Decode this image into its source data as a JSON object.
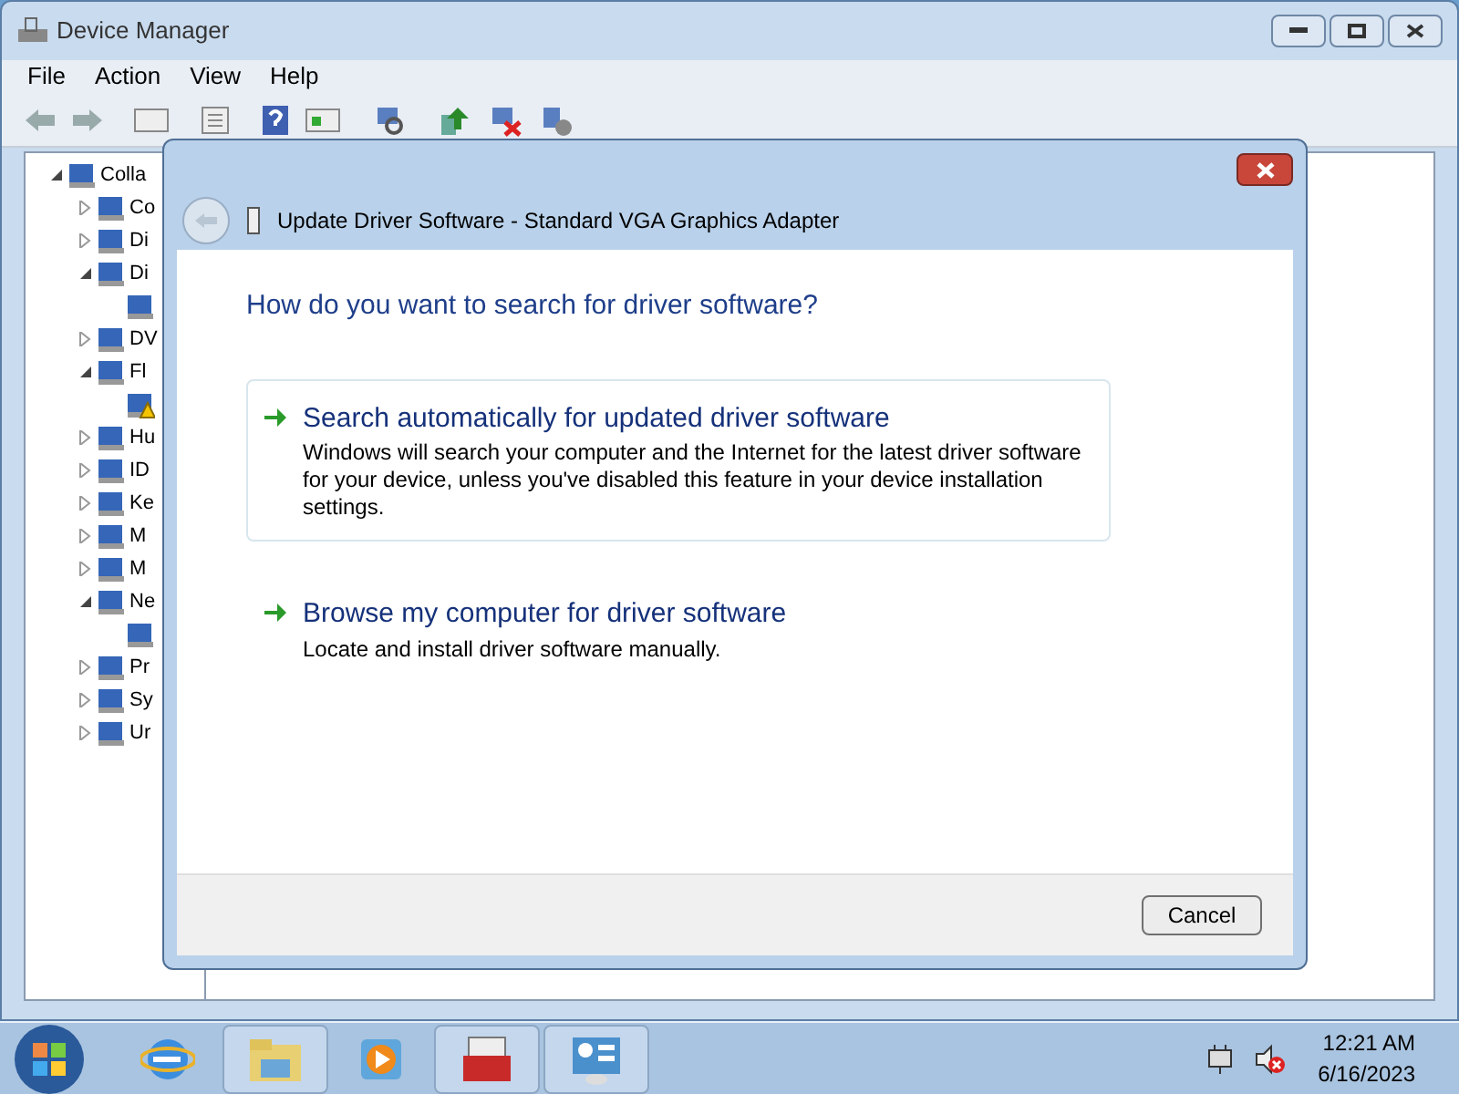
{
  "window": {
    "title": "Device Manager"
  },
  "menu": [
    "File",
    "Action",
    "View",
    "Help"
  ],
  "tree": {
    "label": "Colla",
    "expanded": true,
    "children": [
      {
        "label": "Co",
        "expanded": false
      },
      {
        "label": "Di",
        "expanded": false
      },
      {
        "label": "Di",
        "expanded": true,
        "children": [
          {
            "warning": false
          }
        ]
      },
      {
        "label": "DV",
        "expanded": false
      },
      {
        "label": "Fl",
        "expanded": true,
        "children": [
          {
            "warning": true
          }
        ]
      },
      {
        "label": "Hu",
        "expanded": false
      },
      {
        "label": "ID",
        "expanded": false
      },
      {
        "label": "Ke",
        "expanded": false
      },
      {
        "label": "M",
        "expanded": false
      },
      {
        "label": "M",
        "expanded": false
      },
      {
        "label": "Ne",
        "expanded": true,
        "children": [
          {
            "warning": false
          }
        ]
      },
      {
        "label": "Pr",
        "expanded": false
      },
      {
        "label": "Sy",
        "expanded": false
      },
      {
        "label": "Ur",
        "expanded": false
      }
    ]
  },
  "dialog": {
    "title": "Update Driver Software - Standard VGA Graphics Adapter",
    "heading": "How do you want to search for driver software?",
    "options": [
      {
        "title": "Search automatically for updated driver software",
        "description": "Windows will search your computer and the Internet for the latest driver software for your device, unless you've disabled this feature in your device installation settings.",
        "selected": true
      },
      {
        "title": "Browse my computer for driver software",
        "description": "Locate and install driver software manually.",
        "selected": false
      }
    ],
    "buttons": [
      "Cancel"
    ]
  },
  "taskbar": {
    "time": "12:21 AM",
    "date": "6/16/2023"
  }
}
